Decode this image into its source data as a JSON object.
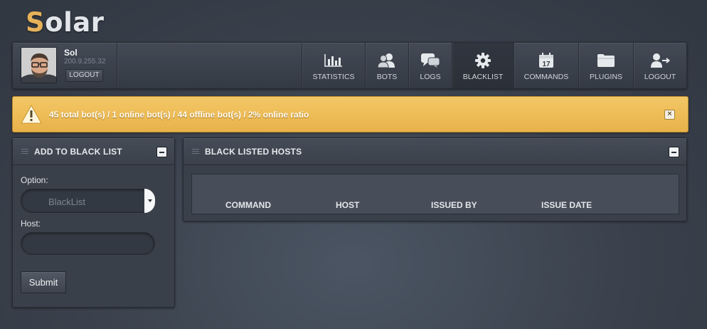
{
  "app": {
    "logo_first": "S",
    "logo_rest": "olar"
  },
  "user": {
    "name": "Sol",
    "ip": "200.9.255.32",
    "logout_label": "LOGOUT"
  },
  "nav": [
    {
      "label": "STATISTICS",
      "icon": "bar-chart-icon",
      "active": false
    },
    {
      "label": "BOTS",
      "icon": "users-icon",
      "active": false
    },
    {
      "label": "LOGS",
      "icon": "chat-bubbles-icon",
      "active": false
    },
    {
      "label": "BLACKLIST",
      "icon": "gear-icon",
      "active": true
    },
    {
      "label": "COMMANDS",
      "icon": "calendar-icon",
      "active": false
    },
    {
      "label": "PLUGINS",
      "icon": "folder-icon",
      "active": false
    },
    {
      "label": "LOGOUT",
      "icon": "user-logout-icon",
      "active": false
    }
  ],
  "calendar_day": "17",
  "alert": {
    "text": "45 total bot(s) / 1 online bot(s) / 44 offline bot(s) / 2% online ratio",
    "close": "×",
    "color": "#f0c05e"
  },
  "add_panel": {
    "title": "ADD TO BLACK LIST",
    "option_label": "Option:",
    "option_selected": "BlackList",
    "host_label": "Host:",
    "host_value": "",
    "submit_label": "Submit"
  },
  "hosts_panel": {
    "title": "BLACK LISTED HOSTS",
    "columns": [
      "COMMAND",
      "HOST",
      "ISSUED BY",
      "ISSUE DATE"
    ]
  }
}
